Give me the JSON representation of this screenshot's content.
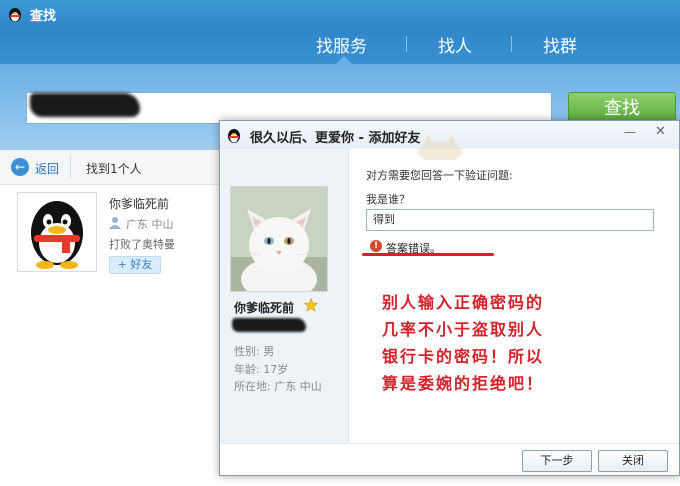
{
  "window": {
    "title": "查找"
  },
  "nav": {
    "tabs": [
      "找服务",
      "找人",
      "找群"
    ]
  },
  "search": {
    "value": "",
    "button_label": "查找"
  },
  "results": {
    "back_label": "返回",
    "count_label": "找到1个人"
  },
  "result_card": {
    "name": "你爹临死前",
    "location": "广东  中山",
    "signature": "打败了奥特曼",
    "add_button": "+ 好友"
  },
  "dialog": {
    "title": "很久以后、更爱你 - 添加好友",
    "profile": {
      "name": "你爹临死前",
      "gender": "性别: 男",
      "age": "年龄: 17岁",
      "location": "所在地: 广东  中山"
    },
    "question_intro": "对方需要您回答一下验证问题:",
    "question": "我是谁？",
    "answer_value": "得到",
    "error_message": "答案错误。",
    "next_button": "下一步",
    "close_button": "关闭"
  },
  "annotation": {
    "lines": [
      "别人输入正确密码的",
      "几率不小于盗取别人",
      "银行卡的密码！所以",
      "算是委婉的拒绝吧！"
    ]
  },
  "colors": {
    "title_blue": "#2f86c8",
    "search_green": "#55a83a",
    "annotation_red": "#d4222a"
  },
  "icons": [
    "qq-penguin-icon",
    "back-arrow-icon",
    "person-icon",
    "star-icon",
    "error-icon",
    "minimize-icon",
    "close-icon"
  ]
}
